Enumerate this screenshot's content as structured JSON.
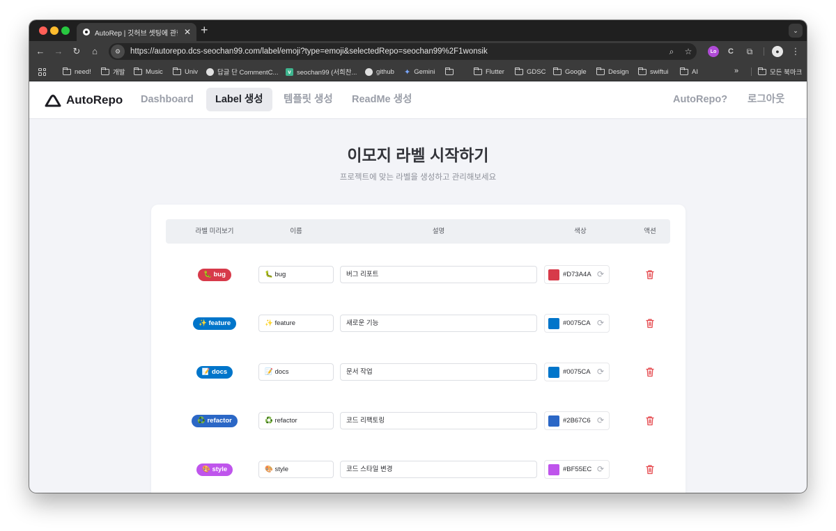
{
  "browser": {
    "tab_title": "AutoRep | 깃허브 셋팅에 관한 모든",
    "tab_close": "✕",
    "new_tab": "+",
    "url": "https://autorepo.dcs-seochan99.com/label/emoji?type=emoji&selectedRepo=seochan99%2F1wonsik",
    "bookmarks": [
      {
        "label": "need!",
        "icon": "folder-icon"
      },
      {
        "label": "개발",
        "icon": "folder-icon"
      },
      {
        "label": "Music",
        "icon": "folder-icon"
      },
      {
        "label": "Univ",
        "icon": "folder-icon"
      },
      {
        "label": "답글 단 CommentC...",
        "icon": "threads-icon"
      },
      {
        "label": "seochan99 (서희찬...",
        "icon": "velog-icon"
      },
      {
        "label": "github",
        "icon": "github-icon"
      },
      {
        "label": "Gemini",
        "icon": "gemini-icon"
      },
      {
        "label": "",
        "icon": "folder-icon"
      },
      {
        "label": "Flutter",
        "icon": "folder-icon"
      },
      {
        "label": "GDSC",
        "icon": "folder-icon"
      },
      {
        "label": "Google",
        "icon": "folder-icon"
      },
      {
        "label": "Design",
        "icon": "folder-icon"
      },
      {
        "label": "swiftui",
        "icon": "folder-icon"
      },
      {
        "label": "AI",
        "icon": "folder-icon"
      }
    ],
    "bookmarks_overflow": "»",
    "all_bookmarks": "모든 북마크",
    "extension_badge": "Lo"
  },
  "site": {
    "logo_text": "AutoRepo",
    "nav": {
      "dashboard": "Dashboard",
      "label": "Label 생성",
      "template": "템플릿 생성",
      "readme": "ReadMe 생성",
      "about": "AutoRepo?",
      "logout": "로그아웃"
    },
    "active_nav": "label"
  },
  "page": {
    "title": "이모지 라벨 시작하기",
    "subtitle": "프로젝트에 맞는 라벨을 생성하고 관리해보세요"
  },
  "table": {
    "headers": {
      "preview": "라벨 미리보기",
      "name": "이름",
      "description": "설명",
      "color": "색상",
      "action": "액션"
    },
    "rows": [
      {
        "badge": "🐛 bug",
        "name": "🐛 bug",
        "description": "버그 리포트",
        "color": "#D73A4A"
      },
      {
        "badge": "✨ feature",
        "name": "✨ feature",
        "description": "새로운 기능",
        "color": "#0075CA"
      },
      {
        "badge": "📝 docs",
        "name": "📝 docs",
        "description": "문서 작업",
        "color": "#0075CA"
      },
      {
        "badge": "♻️ refactor",
        "name": "♻️ refactor",
        "description": "코드 리팩토링",
        "color": "#2B67C6"
      },
      {
        "badge": "🎨 style",
        "name": "🎨 style",
        "description": "코드 스타일 변경",
        "color": "#BF55EC"
      }
    ]
  },
  "colors": {
    "delete": "#e5484d",
    "active_nav_bg": "#e9eaee"
  }
}
